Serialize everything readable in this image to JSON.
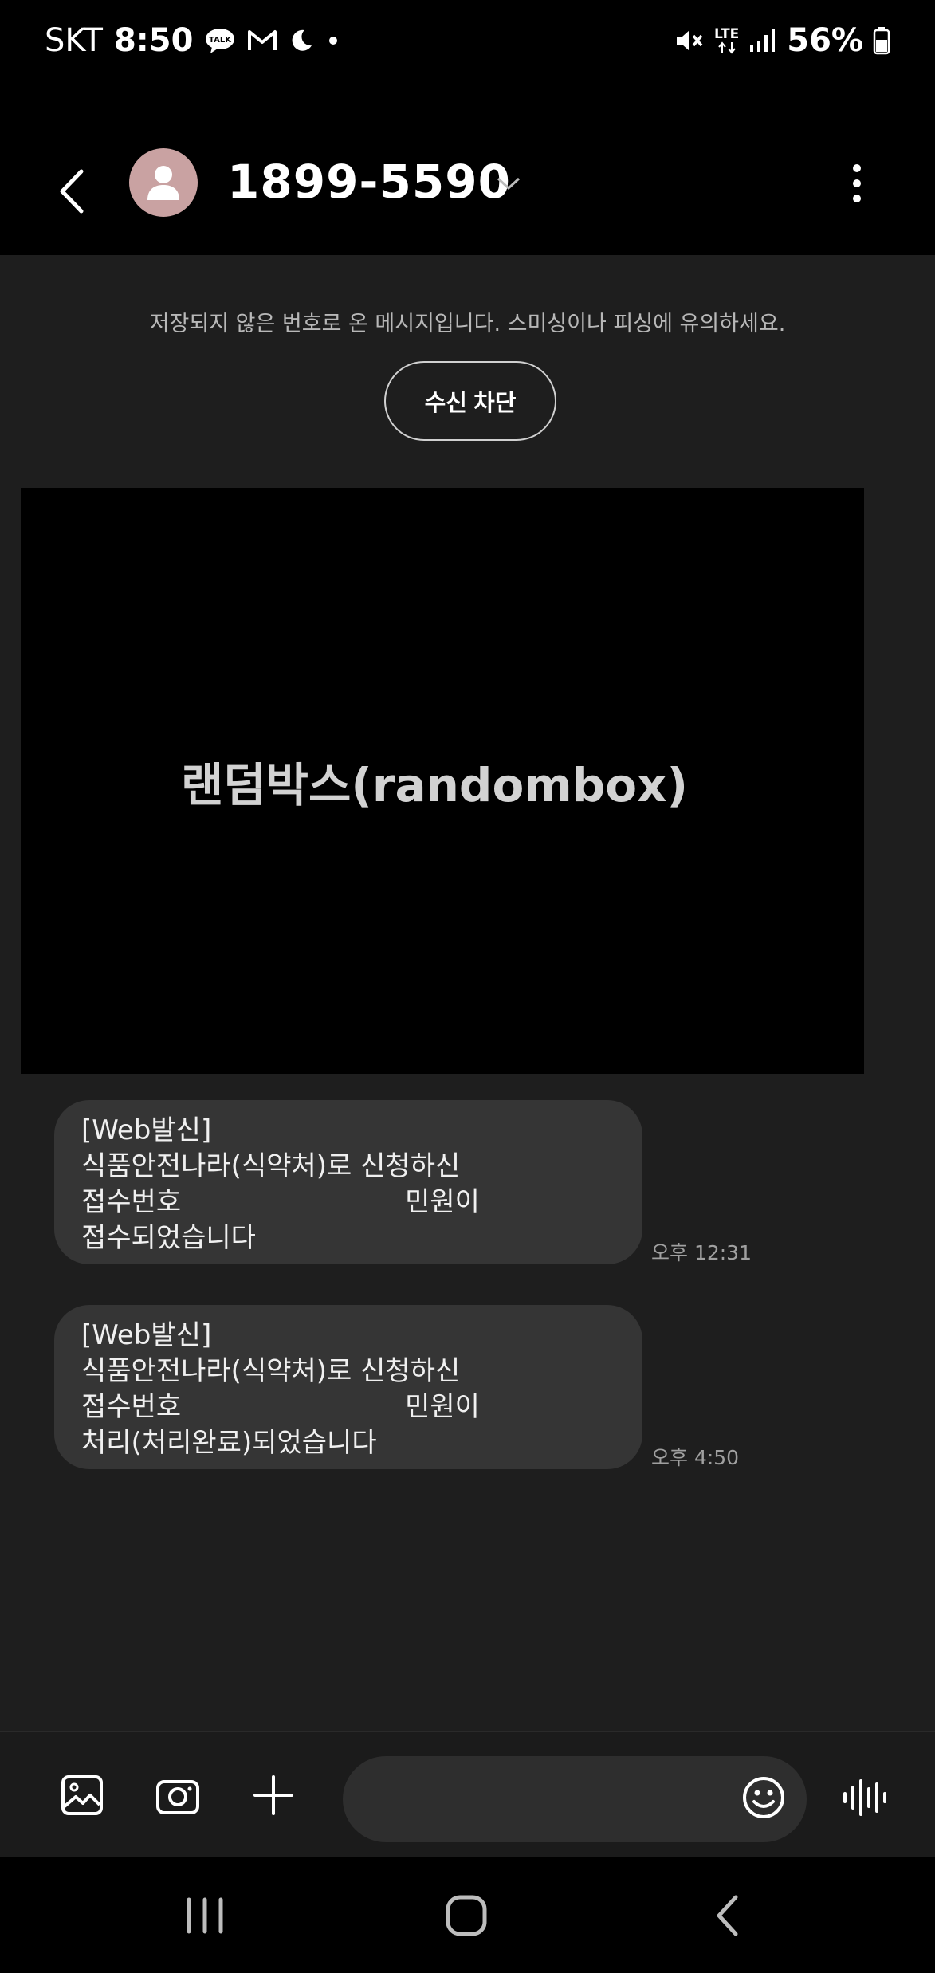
{
  "status_bar": {
    "carrier": "SKT",
    "time": "8:50",
    "battery": "56%",
    "icons": [
      "kakaotalk-icon",
      "mail-icon",
      "moon-icon",
      "dot-icon",
      "mute-icon",
      "lte-icon",
      "signal-icon",
      "battery-icon"
    ],
    "lte_label": "LTE"
  },
  "header": {
    "contact": "1899-5590",
    "icons": [
      "back-arrow-icon",
      "avatar-person-icon",
      "chevron-down-icon",
      "more-vertical-icon"
    ]
  },
  "notice": {
    "text": "저장되지 않은 번호로 온 메시지입니다. 스미싱이나 피싱에 유의하세요.",
    "block_button": "수신 차단"
  },
  "image_message": {
    "caption": "랜덤박스(randombox)"
  },
  "messages": [
    {
      "lines": [
        "[Web발신]",
        "식품안전나라(식약처)로 신청하신",
        "접수번호                          민원이",
        "접수되었습니다"
      ],
      "time": "오후 12:31"
    },
    {
      "lines": [
        "[Web발신]",
        "식품안전나라(식약처)로 신청하신",
        "접수번호                          민원이",
        "처리(처리완료)되었습니다"
      ],
      "time": "오후 4:50"
    }
  ],
  "compose": {
    "input_value": "",
    "icons": [
      "gallery-icon",
      "camera-icon",
      "plus-icon",
      "emoji-icon",
      "voice-icon"
    ]
  },
  "nav_bar": {
    "icons": [
      "recents-icon",
      "home-icon",
      "nav-back-icon"
    ]
  },
  "colors": {
    "background": "#1e1e1e",
    "bar": "#000000",
    "bubble": "#353535",
    "avatar": "#c9a2a2"
  }
}
